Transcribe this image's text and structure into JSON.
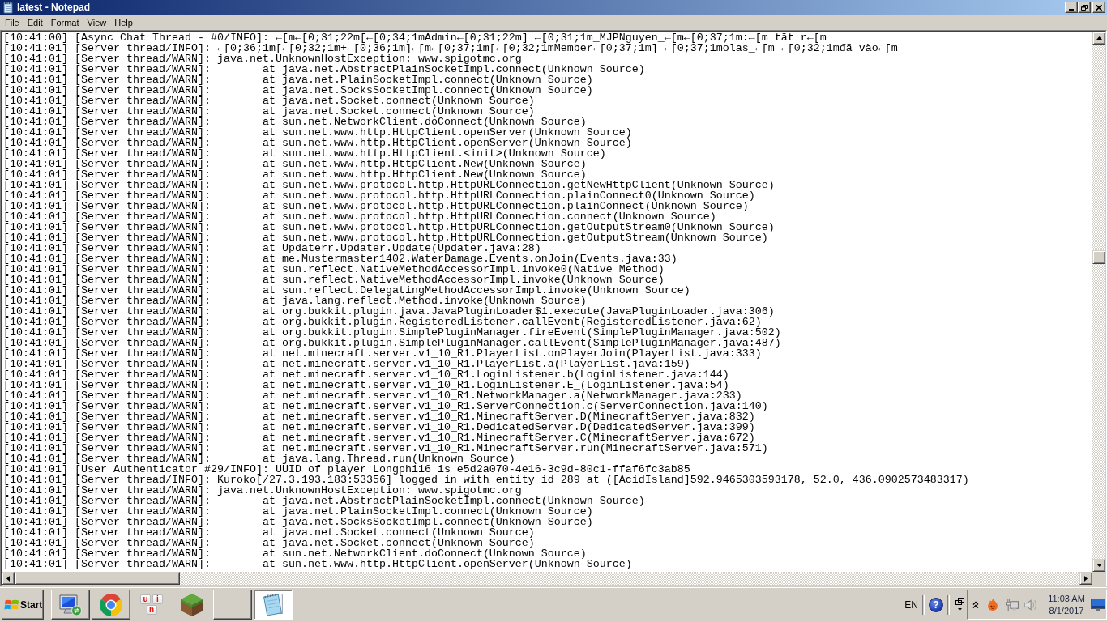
{
  "window": {
    "title": "latest - Notepad"
  },
  "menu": [
    "File",
    "Edit",
    "Format",
    "View",
    "Help"
  ],
  "editor": {
    "lines": [
      "[10:41:00] [Async Chat Thread - #0/INFO]: ←[m←[0;31;22m[←[0;34;1mAdmin←[0;31;22m] ←[0;31;1m_MJPNguyen_←[m←[0;37;1m:←[m tắt r←[m",
      "[10:41:01] [Server thread/INFO]: ←[0;36;1m[←[0;32;1m+←[0;36;1m]←[m←[0;37;1m[←[0;32;1mMember←[0;37;1m] ←[0;37;1molas_←[m ←[0;32;1mđã vào←[m",
      "[10:41:01] [Server thread/WARN]: java.net.UnknownHostException: www.spigotmc.org",
      "[10:41:01] [Server thread/WARN]: \tat java.net.AbstractPlainSocketImpl.connect(Unknown Source)",
      "[10:41:01] [Server thread/WARN]: \tat java.net.PlainSocketImpl.connect(Unknown Source)",
      "[10:41:01] [Server thread/WARN]: \tat java.net.SocksSocketImpl.connect(Unknown Source)",
      "[10:41:01] [Server thread/WARN]: \tat java.net.Socket.connect(Unknown Source)",
      "[10:41:01] [Server thread/WARN]: \tat java.net.Socket.connect(Unknown Source)",
      "[10:41:01] [Server thread/WARN]: \tat sun.net.NetworkClient.doConnect(Unknown Source)",
      "[10:41:01] [Server thread/WARN]: \tat sun.net.www.http.HttpClient.openServer(Unknown Source)",
      "[10:41:01] [Server thread/WARN]: \tat sun.net.www.http.HttpClient.openServer(Unknown Source)",
      "[10:41:01] [Server thread/WARN]: \tat sun.net.www.http.HttpClient.<init>(Unknown Source)",
      "[10:41:01] [Server thread/WARN]: \tat sun.net.www.http.HttpClient.New(Unknown Source)",
      "[10:41:01] [Server thread/WARN]: \tat sun.net.www.http.HttpClient.New(Unknown Source)",
      "[10:41:01] [Server thread/WARN]: \tat sun.net.www.protocol.http.HttpURLConnection.getNewHttpClient(Unknown Source)",
      "[10:41:01] [Server thread/WARN]: \tat sun.net.www.protocol.http.HttpURLConnection.plainConnect0(Unknown Source)",
      "[10:41:01] [Server thread/WARN]: \tat sun.net.www.protocol.http.HttpURLConnection.plainConnect(Unknown Source)",
      "[10:41:01] [Server thread/WARN]: \tat sun.net.www.protocol.http.HttpURLConnection.connect(Unknown Source)",
      "[10:41:01] [Server thread/WARN]: \tat sun.net.www.protocol.http.HttpURLConnection.getOutputStream0(Unknown Source)",
      "[10:41:01] [Server thread/WARN]: \tat sun.net.www.protocol.http.HttpURLConnection.getOutputStream(Unknown Source)",
      "[10:41:01] [Server thread/WARN]: \tat Updaterr.Updater.Update(Updater.java:28)",
      "[10:41:01] [Server thread/WARN]: \tat me.Mustermaster1402.WaterDamage.Events.onJoin(Events.java:33)",
      "[10:41:01] [Server thread/WARN]: \tat sun.reflect.NativeMethodAccessorImpl.invoke0(Native Method)",
      "[10:41:01] [Server thread/WARN]: \tat sun.reflect.NativeMethodAccessorImpl.invoke(Unknown Source)",
      "[10:41:01] [Server thread/WARN]: \tat sun.reflect.DelegatingMethodAccessorImpl.invoke(Unknown Source)",
      "[10:41:01] [Server thread/WARN]: \tat java.lang.reflect.Method.invoke(Unknown Source)",
      "[10:41:01] [Server thread/WARN]: \tat org.bukkit.plugin.java.JavaPluginLoader$1.execute(JavaPluginLoader.java:306)",
      "[10:41:01] [Server thread/WARN]: \tat org.bukkit.plugin.RegisteredListener.callEvent(RegisteredListener.java:62)",
      "[10:41:01] [Server thread/WARN]: \tat org.bukkit.plugin.SimplePluginManager.fireEvent(SimplePluginManager.java:502)",
      "[10:41:01] [Server thread/WARN]: \tat org.bukkit.plugin.SimplePluginManager.callEvent(SimplePluginManager.java:487)",
      "[10:41:01] [Server thread/WARN]: \tat net.minecraft.server.v1_10_R1.PlayerList.onPlayerJoin(PlayerList.java:333)",
      "[10:41:01] [Server thread/WARN]: \tat net.minecraft.server.v1_10_R1.PlayerList.a(PlayerList.java:159)",
      "[10:41:01] [Server thread/WARN]: \tat net.minecraft.server.v1_10_R1.LoginListener.b(LoginListener.java:144)",
      "[10:41:01] [Server thread/WARN]: \tat net.minecraft.server.v1_10_R1.LoginListener.E_(LoginListener.java:54)",
      "[10:41:01] [Server thread/WARN]: \tat net.minecraft.server.v1_10_R1.NetworkManager.a(NetworkManager.java:233)",
      "[10:41:01] [Server thread/WARN]: \tat net.minecraft.server.v1_10_R1.ServerConnection.c(ServerConnection.java:140)",
      "[10:41:01] [Server thread/WARN]: \tat net.minecraft.server.v1_10_R1.MinecraftServer.D(MinecraftServer.java:832)",
      "[10:41:01] [Server thread/WARN]: \tat net.minecraft.server.v1_10_R1.DedicatedServer.D(DedicatedServer.java:399)",
      "[10:41:01] [Server thread/WARN]: \tat net.minecraft.server.v1_10_R1.MinecraftServer.C(MinecraftServer.java:672)",
      "[10:41:01] [Server thread/WARN]: \tat net.minecraft.server.v1_10_R1.MinecraftServer.run(MinecraftServer.java:571)",
      "[10:41:01] [Server thread/WARN]: \tat java.lang.Thread.run(Unknown Source)",
      "[10:41:01] [User Authenticator #29/INFO]: UUID of player Longphi16 is e5d2a070-4e16-3c9d-80c1-ffaf6fc3ab85",
      "[10:41:01] [Server thread/INFO]: Kuroko[/27.3.193.183:53356] logged in with entity id 289 at ([AcidIsland]592.9465303593178, 52.0, 436.0902573483317)",
      "[10:41:01] [Server thread/WARN]: java.net.UnknownHostException: www.spigotmc.org",
      "[10:41:01] [Server thread/WARN]: \tat java.net.AbstractPlainSocketImpl.connect(Unknown Source)",
      "[10:41:01] [Server thread/WARN]: \tat java.net.PlainSocketImpl.connect(Unknown Source)",
      "[10:41:01] [Server thread/WARN]: \tat java.net.SocksSocketImpl.connect(Unknown Source)",
      "[10:41:01] [Server thread/WARN]: \tat java.net.Socket.connect(Unknown Source)",
      "[10:41:01] [Server thread/WARN]: \tat java.net.Socket.connect(Unknown Source)",
      "[10:41:01] [Server thread/WARN]: \tat sun.net.NetworkClient.doConnect(Unknown Source)",
      "[10:41:01] [Server thread/WARN]: \tat sun.net.www.http.HttpClient.openServer(Unknown Source)"
    ]
  },
  "taskbar": {
    "start": "Start",
    "buttons": [
      {
        "raised": true,
        "selected": false
      },
      {
        "raised": true,
        "selected": false
      },
      {
        "raised": false,
        "selected": false,
        "keys": [
          "u",
          "i",
          "n"
        ]
      },
      {
        "raised": false,
        "selected": false
      },
      {
        "raised": true,
        "selected": false
      },
      {
        "raised": true,
        "selected": true
      }
    ],
    "language": "EN",
    "help": "?",
    "clock": {
      "time": "11:03 AM",
      "date": "8/1/2017"
    }
  }
}
